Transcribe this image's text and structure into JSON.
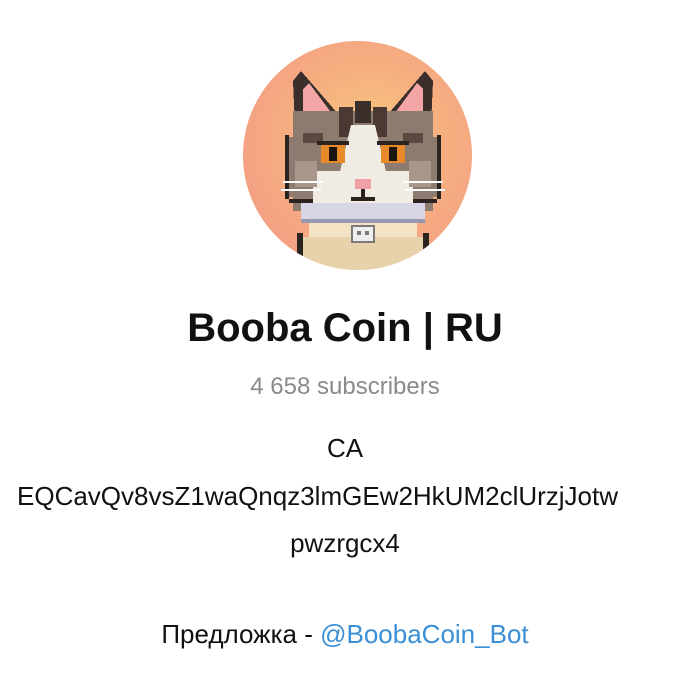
{
  "channel": {
    "avatar_icon": "pixel-cat-avatar-icon",
    "title": "Booba Coin | RU",
    "subscribers": "4 658 subscribers",
    "description": {
      "ca_label": "CA",
      "ca_address_line1": "EQCavQv8vsZ1waQnqz3lmGEw2HkUM2clUrzjJotw",
      "ca_address_line2": "pwzrgcx4",
      "suggest_label": "Предложка - ",
      "suggest_link": "@BoobaCoin_Bot"
    }
  },
  "colors": {
    "link": "#3a8fd6",
    "muted_text": "#8a8a8a",
    "avatar_gradient_center": "#f9c87e",
    "avatar_gradient_edge": "#f29487"
  }
}
